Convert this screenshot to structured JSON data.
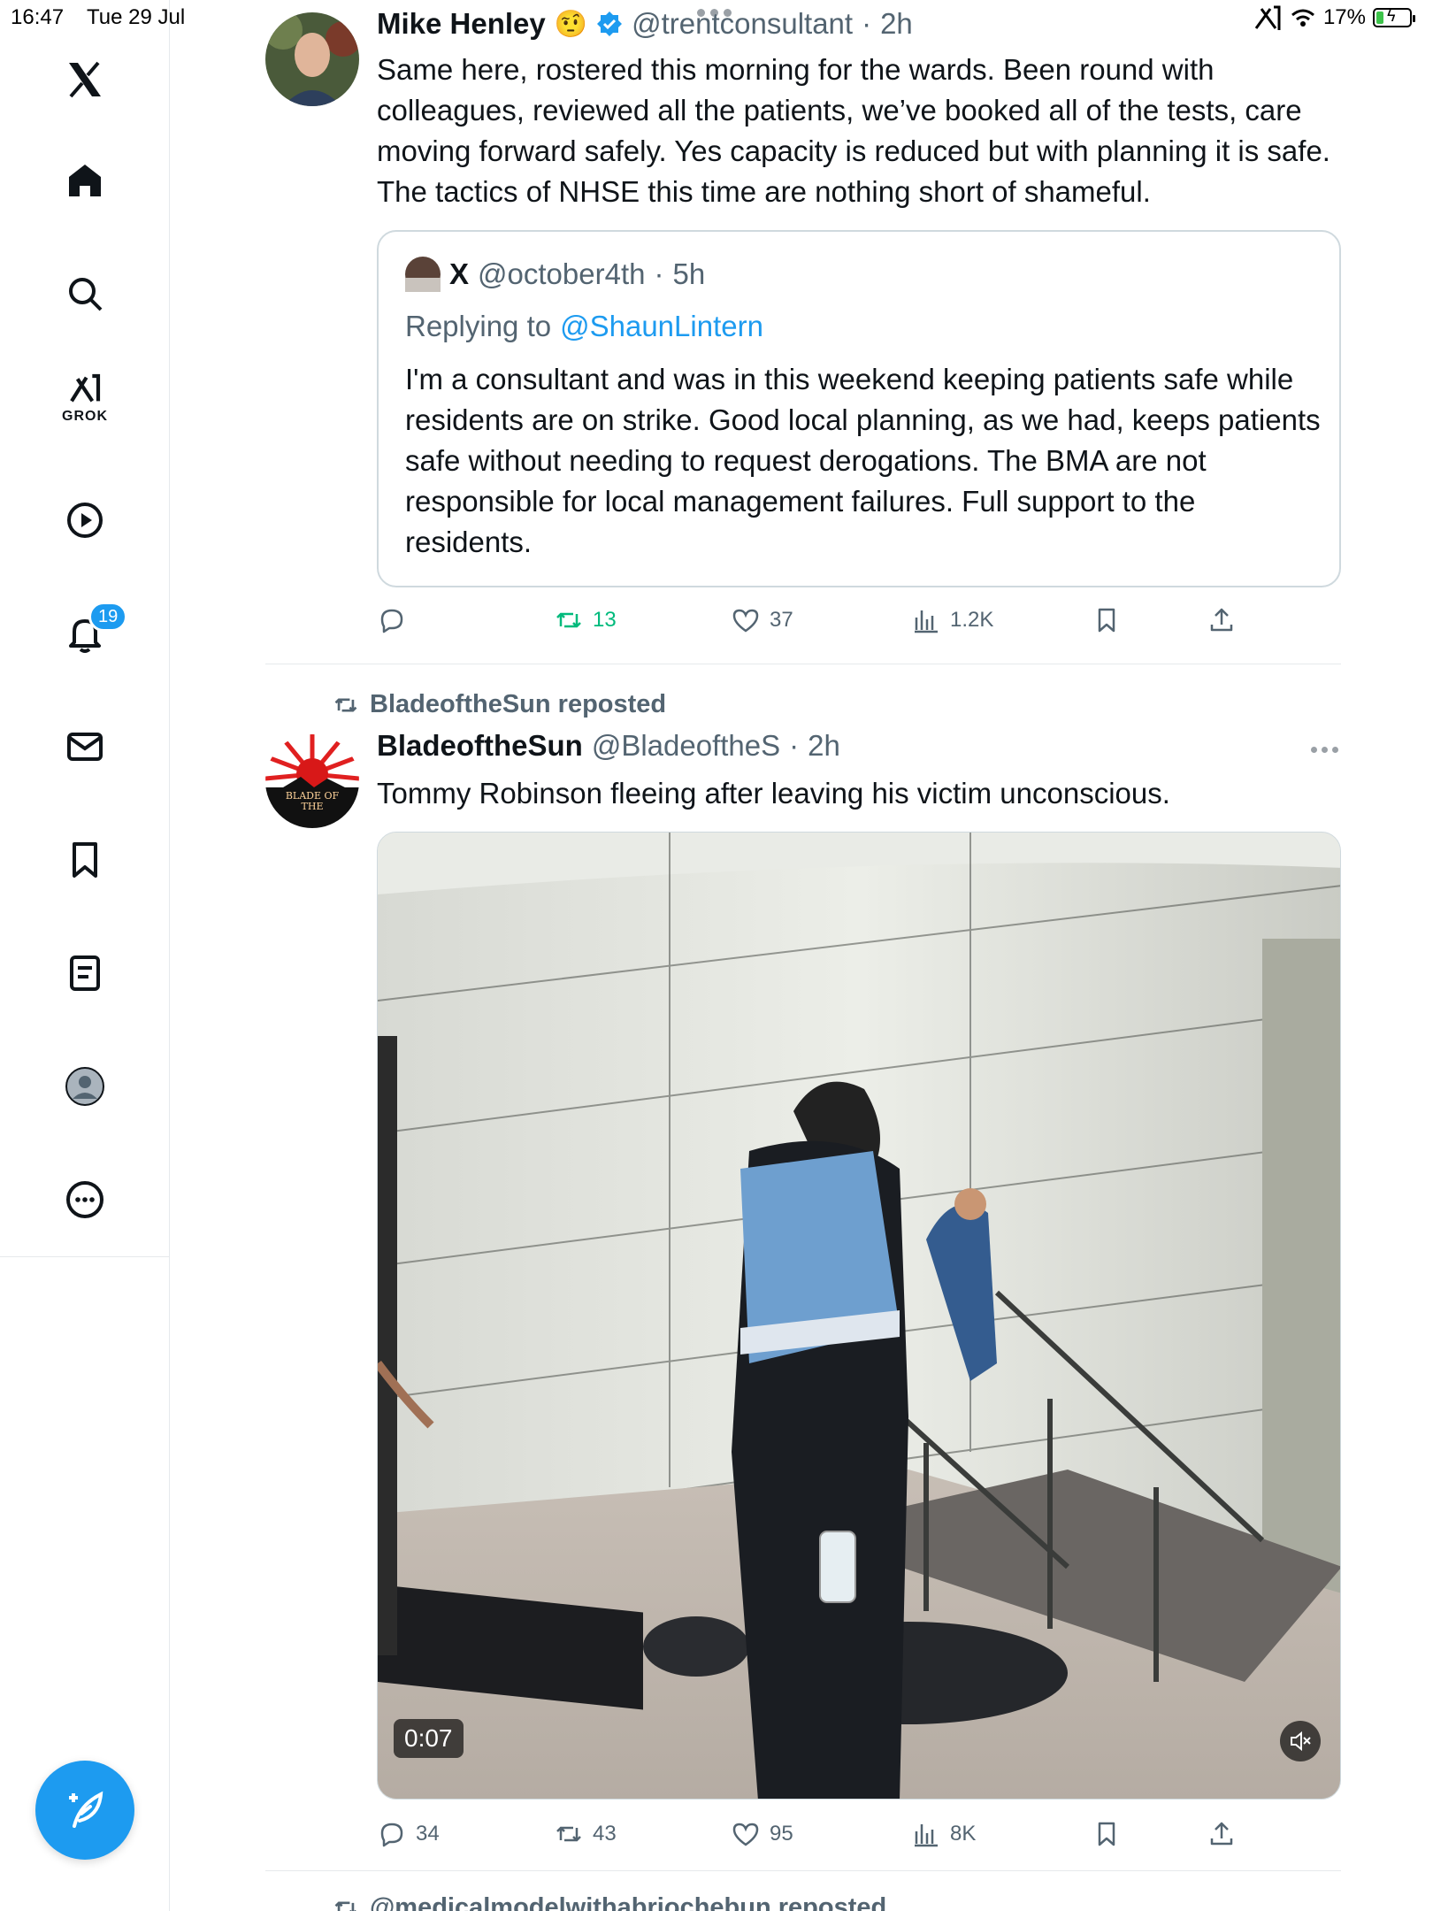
{
  "status_bar": {
    "time": "16:47",
    "date": "Tue 29 Jul",
    "battery": "17%"
  },
  "sidebar": {
    "grok_label": "GROK",
    "notifications_badge": "19",
    "items": [
      "x-logo",
      "home-icon",
      "search-icon",
      "grok-icon",
      "video-icon",
      "notifications-icon",
      "messages-icon",
      "bookmarks-icon",
      "lists-icon",
      "profile-icon",
      "more-icon"
    ]
  },
  "tweets": [
    {
      "display_name": "Mike Henley",
      "emoji": "🤨",
      "handle": "@trentconsultant",
      "dot": "·",
      "time": "2h",
      "text": "Same here, rostered this morning for the wards. Been round with colleagues, reviewed all the patients, we’ve booked all of the tests, care moving forward safely. Yes capacity is reduced but with planning it is safe. The tactics of NHSE this time are nothing short of shameful.",
      "quote": {
        "display_name": "X",
        "handle": "@october4th",
        "dot": "·",
        "time": "5h",
        "replying_prefix": "Replying to",
        "replying_handle": "@ShaunLintern",
        "text": "I'm a consultant and was in this weekend keeping patients safe while residents are on strike. Good local planning, as we had, keeps patients safe without needing to request derogations. The BMA are not responsible for local management failures. Full support to the residents."
      },
      "actions": {
        "replies": "",
        "retweets": "13",
        "likes": "37",
        "views": "1.2K"
      }
    },
    {
      "repost_label": "BladeoftheSun reposted",
      "display_name": "BladeoftheSun",
      "handle": "@BladeoftheS",
      "dot": "·",
      "time": "2h",
      "text": "Tommy Robinson fleeing after leaving his victim unconscious.",
      "avatar_text": "BLADE OF THE",
      "video": {
        "duration": "0:07"
      },
      "actions": {
        "replies": "34",
        "retweets": "43",
        "likes": "95",
        "views": "8K"
      }
    }
  ],
  "next_repost_label": "@medicalmodelwithabriochebun reposted",
  "colors": {
    "accent": "#1d9bf0",
    "retweet_green": "#00ba7c",
    "text_secondary": "#536471"
  }
}
